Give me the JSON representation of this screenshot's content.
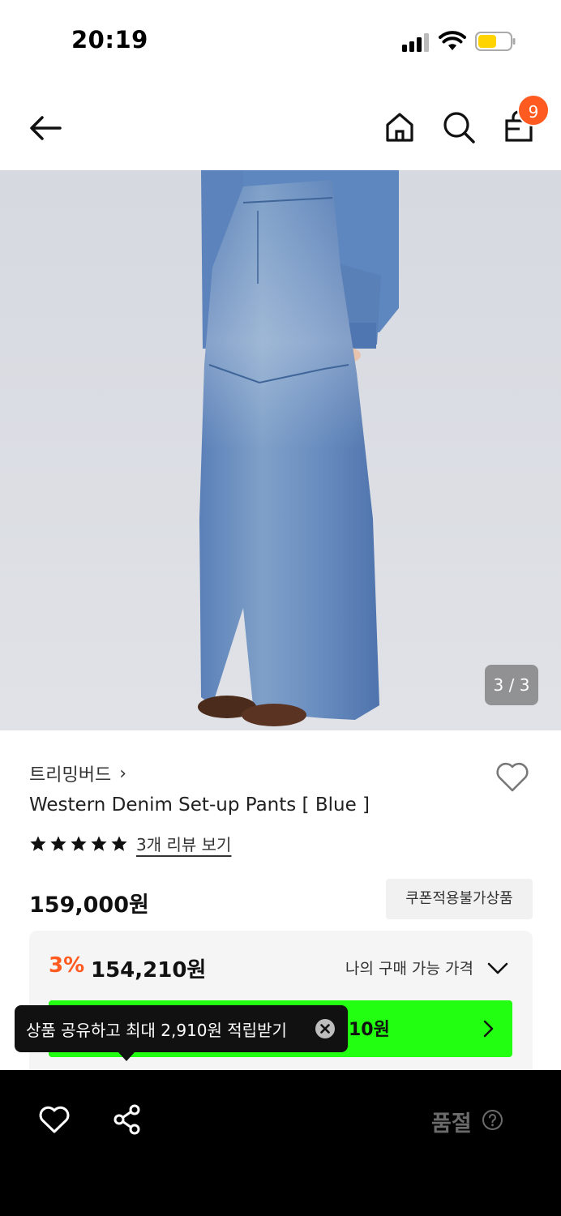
{
  "status_bar": {
    "time": "20:19",
    "battery_color": "#ffd400"
  },
  "nav": {
    "cart_count": "9",
    "badge_color": "#ff5a1f"
  },
  "gallery": {
    "counter": "3 / 3"
  },
  "product": {
    "brand": "트리밍버드",
    "brand_chevron": "›",
    "title": "Western Denim Set-up Pants [ Blue ]",
    "rating_stars": 5,
    "review_link": "3개 리뷰 보기",
    "price": "159,000원",
    "coupon_badge": "쿠폰적용불가상품"
  },
  "price_box": {
    "discount_rate": "3%",
    "discount_price": "154,210원",
    "my_price_label": "나의 구매 가능 가격",
    "green_bar_text": "10원",
    "accent_color": "#22ff10"
  },
  "tooltip": {
    "text": "상품 공유하고 최대 2,910원 적립받기"
  },
  "bottom_bar": {
    "soldout_label": "품절"
  },
  "icons": [
    "back-arrow-icon",
    "home-icon",
    "search-icon",
    "shopping-bag-icon",
    "heart-icon",
    "share-icon",
    "close-icon",
    "help-icon",
    "chevron-down-icon",
    "chevron-right-icon",
    "star-icon"
  ]
}
